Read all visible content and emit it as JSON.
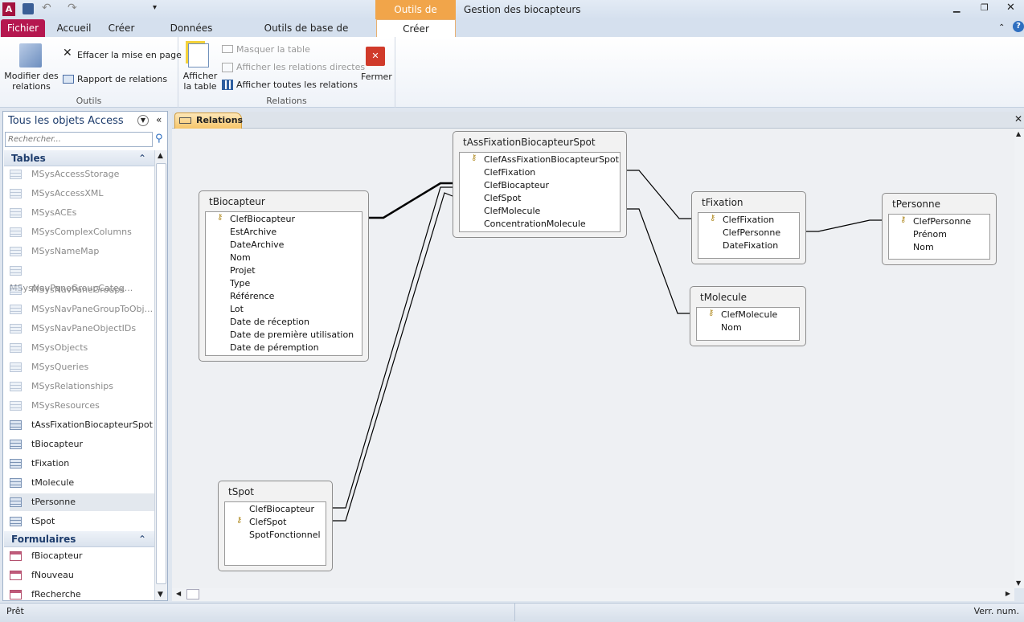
{
  "window": {
    "title": "Gestion des biocapteurs",
    "context_tab": "Outils de relation"
  },
  "ribbon_tabs": [
    "Fichier",
    "Accueil",
    "Créer",
    "Données externes",
    "Outils de base de données",
    "Créer"
  ],
  "ribbon": {
    "outils": {
      "label": "Outils",
      "modifier": "Modifier des relations",
      "effacer": "Effacer la mise en page",
      "rapport": "Rapport de relations"
    },
    "relations": {
      "label": "Relations",
      "afficher_table": "Afficher la table",
      "masquer": "Masquer la table",
      "directes": "Afficher les relations directes",
      "toutes": "Afficher toutes les relations",
      "fermer": "Fermer"
    }
  },
  "nav": {
    "title": "Tous les objets Access",
    "search_placeholder": "Rechercher...",
    "tables_header": "Tables",
    "tables": [
      "MSysAccessStorage",
      "MSysAccessXML",
      "MSysACEs",
      "MSysComplexColumns",
      "MSysNameMap",
      "MSysNavPaneGroupCateg...",
      "MSysNavPaneGroups",
      "MSysNavPaneGroupToObj...",
      "MSysNavPaneObjectIDs",
      "MSysObjects",
      "MSysQueries",
      "MSysRelationships",
      "MSysResources",
      "tAssFixationBiocapteurSpot",
      "tBiocapteur",
      "tFixation",
      "tMolecule",
      "tPersonne",
      "tSpot"
    ],
    "forms_header": "Formulaires",
    "forms": [
      "fBiocapteur",
      "fNouveau",
      "fRecherche"
    ]
  },
  "doc_tab": "Relations",
  "tables": {
    "tAss": {
      "name": "tAssFixationBiocapteurSpot",
      "fields": [
        "ClefAssFixationBiocapteurSpot",
        "ClefFixation",
        "ClefBiocapteur",
        "ClefSpot",
        "ClefMolecule",
        "ConcentrationMolecule"
      ]
    },
    "tBio": {
      "name": "tBiocapteur",
      "fields": [
        "ClefBiocapteur",
        "EstArchive",
        "DateArchive",
        "Nom",
        "Projet",
        "Type",
        "Référence",
        "Lot",
        "Date de réception",
        "Date de première utilisation",
        "Date de péremption"
      ]
    },
    "tFix": {
      "name": "tFixation",
      "fields": [
        "ClefFixation",
        "ClefPersonne",
        "DateFixation"
      ]
    },
    "tPers": {
      "name": "tPersonne",
      "fields": [
        "ClefPersonne",
        "Prénom",
        "Nom"
      ]
    },
    "tMol": {
      "name": "tMolecule",
      "fields": [
        "ClefMolecule",
        "Nom"
      ]
    },
    "tSpot": {
      "name": "tSpot",
      "fields": [
        "ClefBiocapteur",
        "ClefSpot",
        "SpotFonctionnel"
      ]
    }
  },
  "status": {
    "left": "Prêt",
    "right": "Verr. num."
  },
  "colors": {
    "fichier": "#b5174f",
    "context": "#f1a54a",
    "nav_header": "#1e3d6d"
  }
}
